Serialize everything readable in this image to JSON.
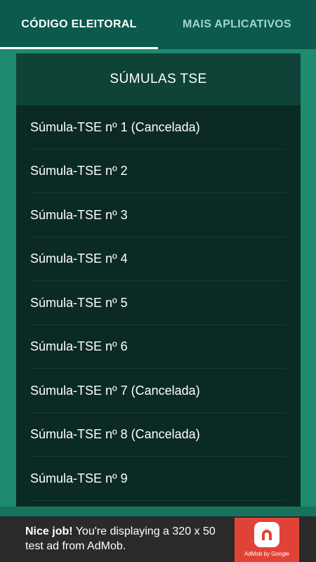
{
  "tabs": [
    {
      "label": "CÓDIGO ELEITORAL",
      "active": true
    },
    {
      "label": "MAIS APLICATIVOS",
      "active": false
    }
  ],
  "panel": {
    "title": "SÚMULAS TSE",
    "items": [
      "Súmula-TSE nº 1 (Cancelada)",
      "Súmula-TSE nº 2",
      "Súmula-TSE nº 3",
      "Súmula-TSE nº 4",
      "Súmula-TSE nº 5",
      "Súmula-TSE nº 6",
      "Súmula-TSE nº 7 (Cancelada)",
      "Súmula-TSE nº 8 (Cancelada)",
      "Súmula-TSE nº 9"
    ]
  },
  "ad": {
    "headline": "Nice job!",
    "body": " You're displaying a 320 x 50 test ad from AdMob.",
    "logo_caption": "AdMob by Google",
    "logo_icon": "admob-icon"
  },
  "colors": {
    "tabbar": "#0b5a4d",
    "background": "#1e8a70",
    "panel": "#0b2a24",
    "panel_header": "#0f4338",
    "ad_logo": "#e04336"
  }
}
